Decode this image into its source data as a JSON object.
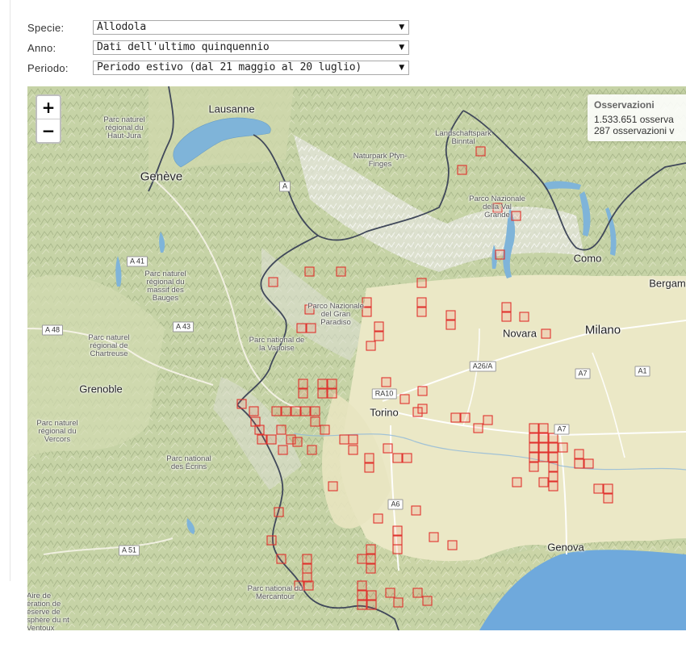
{
  "filters": [
    {
      "label": "Specie:",
      "value": "Allodola"
    },
    {
      "label": "Anno:",
      "value": "Dati dell'ultimo quinquennio"
    },
    {
      "label": "Periodo:",
      "value": "Periodo estivo (dal 21 maggio al 20 luglio)"
    }
  ],
  "dropdown_arrow": "▼",
  "map": {
    "zoom_in": "+",
    "zoom_out": "−",
    "observations": {
      "title": "Osservazioni",
      "line1": "1.533.651 osserva",
      "line2": "287 osservazioni v"
    },
    "colors": {
      "cell_stroke": "#e0332e",
      "lake": "#7fb4d9",
      "sea": "#6fa9dc",
      "plain": "#e9e6c4",
      "mountain": "#b9c79b",
      "border": "#40485a"
    },
    "cities": [
      {
        "name": "Lausanne",
        "size": "m"
      },
      {
        "name": "Genève",
        "size": "l"
      },
      {
        "name": "Como",
        "size": "m"
      },
      {
        "name": "Bergam",
        "size": "m"
      },
      {
        "name": "Novara",
        "size": "m"
      },
      {
        "name": "Milano",
        "size": "l"
      },
      {
        "name": "Grenoble",
        "size": "m"
      },
      {
        "name": "Torino",
        "size": "m"
      },
      {
        "name": "Genova",
        "size": "m"
      }
    ],
    "parks": [
      "Parc naturel régional du Haut-Jura",
      "Landschaftspark Binntal",
      "Naturpark Pfyn-Finges",
      "Parco Nazionale della Val Grande",
      "Parc naturel régional du massif des Bauges",
      "Parco Nazionale del Gran Paradiso",
      "Parc naturel régional de Chartreuse",
      "Parc national de la Vanoise",
      "Parc naturel régional du Vercors",
      "Parc national des Écrins",
      "Parc national du Mercantour",
      "Aire de ération de éserve de sphère du nt Ventoux"
    ],
    "roads": [
      "A",
      "A 41",
      "A 48",
      "A 43",
      "RA10",
      "A26/A",
      "A7",
      "A1",
      "A7",
      "A6",
      "A 51"
    ]
  }
}
